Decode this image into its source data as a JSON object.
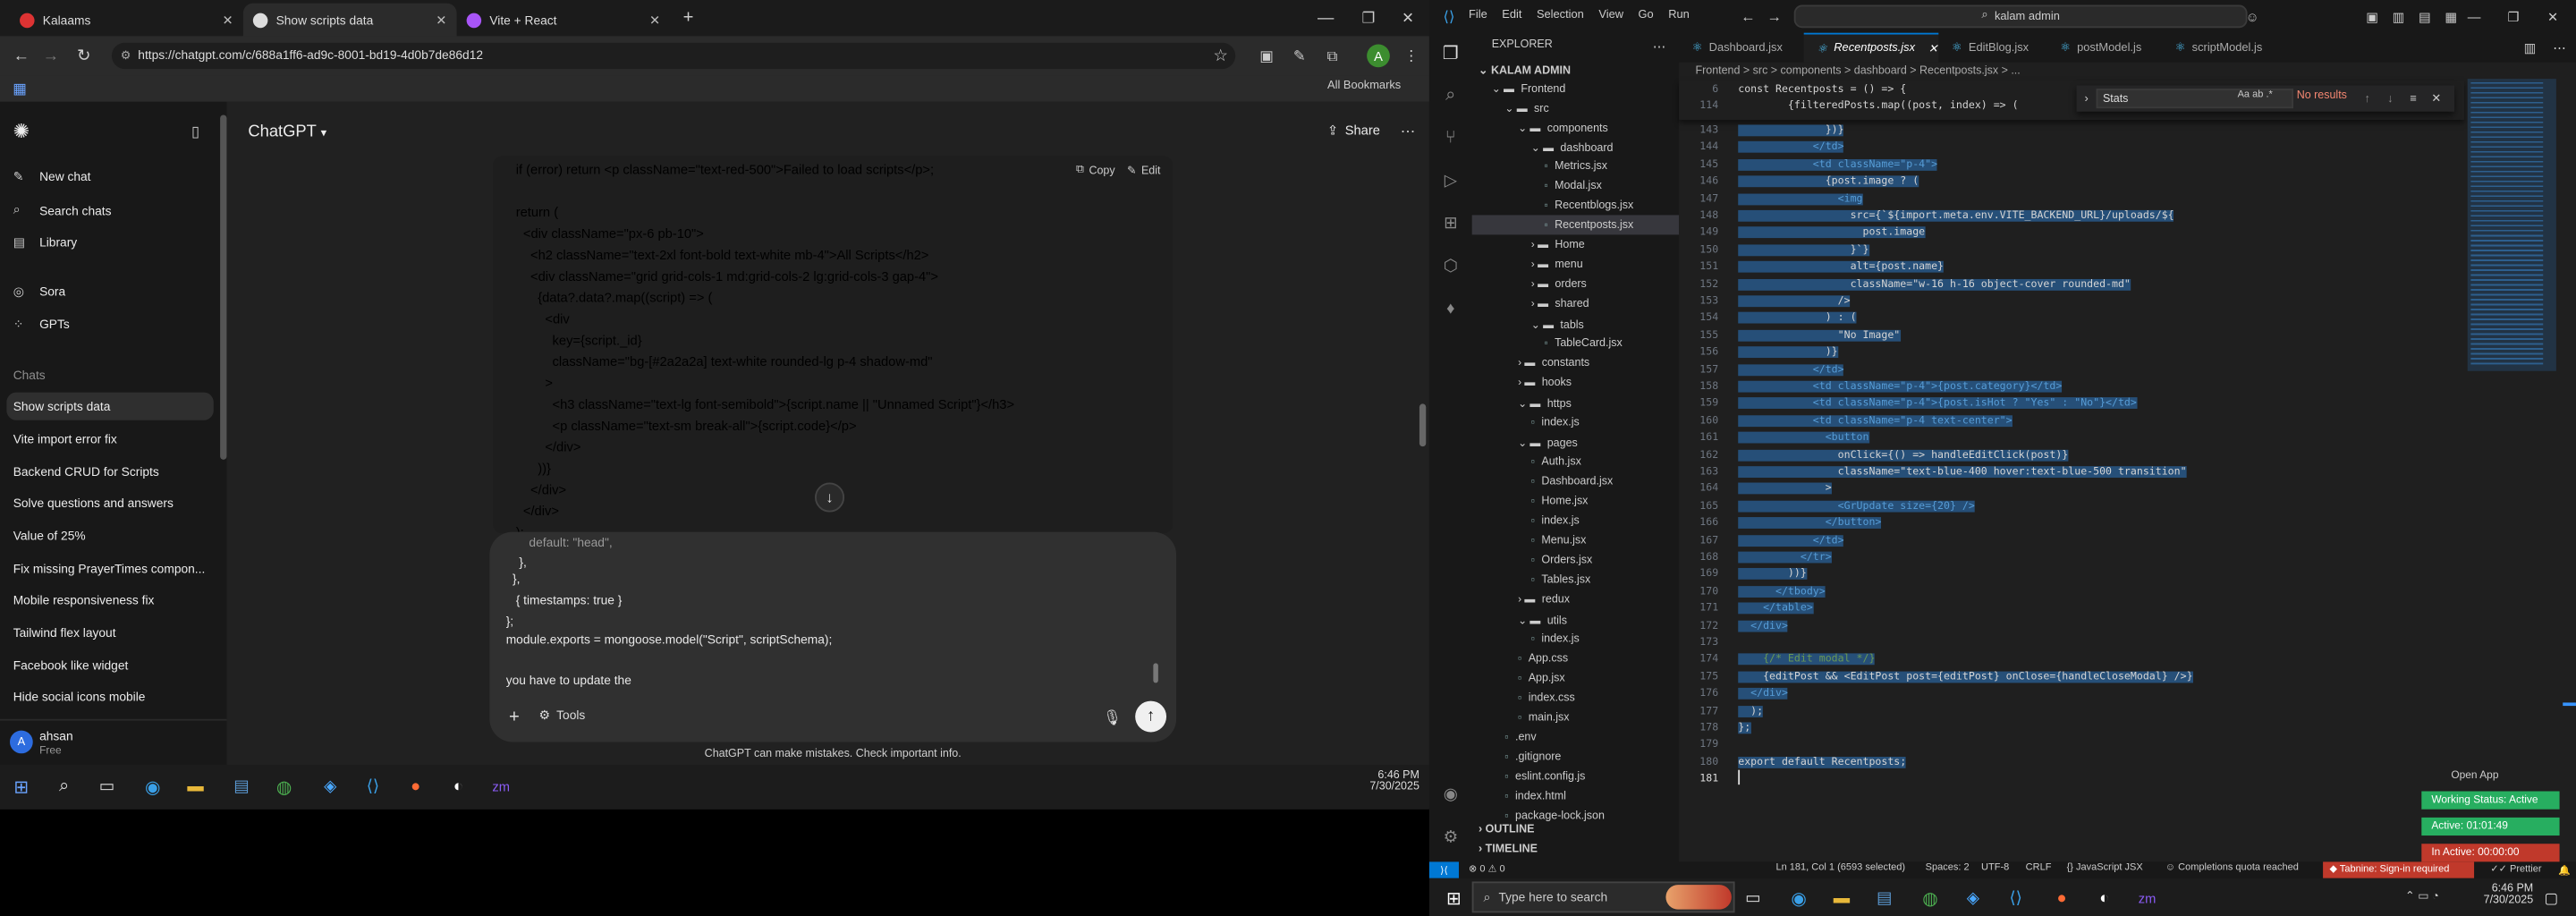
{
  "browser": {
    "tabs": [
      {
        "title": "Kalaams"
      },
      {
        "title": "Show scripts data"
      },
      {
        "title": "Vite + React"
      }
    ],
    "url": "https://chatgpt.com/c/688a1ff6-ad9c-8001-bd19-4d0b7de86d12",
    "bookmarks_label": "All Bookmarks"
  },
  "chatgpt": {
    "sidebar": {
      "top_items": [
        {
          "label": "New chat",
          "icon": "edit-icon"
        },
        {
          "label": "Search chats",
          "icon": "search-icon"
        },
        {
          "label": "Library",
          "icon": "library-icon"
        }
      ],
      "apps": [
        {
          "label": "Sora"
        },
        {
          "label": "GPTs"
        }
      ],
      "chats_heading": "Chats",
      "chats": [
        "Show scripts data",
        "Vite import error fix",
        "Backend CRUD for Scripts",
        "Solve questions and answers",
        "Value of 25%",
        "Fix missing PrayerTimes compon...",
        "Mobile responsiveness fix",
        "Tailwind flex layout",
        "Facebook like widget",
        "Hide social icons mobile"
      ],
      "user": {
        "name": "ahsan",
        "plan": "Free",
        "initial": "A"
      }
    },
    "header": {
      "title": "ChatGPT",
      "share": "Share"
    },
    "code": {
      "copy": "Copy",
      "edit": "Edit",
      "lines": [
        "if (error) return <p className=\"text-red-500\">Failed to load scripts</p>;",
        "",
        "return (",
        "  <div className=\"px-6 pb-10\">",
        "    <h2 className=\"text-2xl font-bold text-white mb-4\">All Scripts</h2>",
        "    <div className=\"grid grid-cols-1 md:grid-cols-2 lg:grid-cols-3 gap-4\">",
        "      {data?.data?.map((script) => (",
        "        <div",
        "          key={script._id}",
        "          className=\"bg-[#2a2a2a] text-white rounded-lg p-4 shadow-md\"",
        "        >",
        "          <h3 className=\"text-lg font-semibold\">{script.name || \"Unnamed Script\"}</h3>",
        "          <p className=\"text-sm break-all\">{script.code}</p>",
        "        </div>",
        "      ))}",
        "    </div>",
        "  </div>",
        ");"
      ]
    },
    "prompt": {
      "lines": [
        "default: \"head\",",
        "},",
        "},",
        "{ timestamps: true }",
        "};",
        "module.exports = mongoose.model(\"Script\", scriptSchema);",
        "",
        "you have to update the"
      ],
      "tools": "Tools"
    },
    "disclaimer": "ChatGPT can make mistakes. Check important info.",
    "taskbar": {
      "time": "6:46 PM",
      "date": "7/30/2025"
    }
  },
  "vscode": {
    "menu": [
      "File",
      "Edit",
      "Selection",
      "View",
      "Go",
      "Run"
    ],
    "search": "kalam admin",
    "explorer_title": "EXPLORER",
    "root": "KALAM ADMIN",
    "tree": [
      {
        "label": "Frontend",
        "depth": 0,
        "type": "folder-open"
      },
      {
        "label": "src",
        "depth": 1,
        "type": "folder-open"
      },
      {
        "label": "components",
        "depth": 2,
        "type": "folder-open"
      },
      {
        "label": "dashboard",
        "depth": 3,
        "type": "folder-open"
      },
      {
        "label": "Metrics.jsx",
        "depth": 4,
        "type": "file"
      },
      {
        "label": "Modal.jsx",
        "depth": 4,
        "type": "file"
      },
      {
        "label": "Recentblogs.jsx",
        "depth": 4,
        "type": "file"
      },
      {
        "label": "Recentposts.jsx",
        "depth": 4,
        "type": "file",
        "active": true
      },
      {
        "label": "Home",
        "depth": 3,
        "type": "folder"
      },
      {
        "label": "menu",
        "depth": 3,
        "type": "folder"
      },
      {
        "label": "orders",
        "depth": 3,
        "type": "folder"
      },
      {
        "label": "shared",
        "depth": 3,
        "type": "folder"
      },
      {
        "label": "tabls",
        "depth": 3,
        "type": "folder-open"
      },
      {
        "label": "TableCard.jsx",
        "depth": 4,
        "type": "file"
      },
      {
        "label": "constants",
        "depth": 2,
        "type": "folder"
      },
      {
        "label": "hooks",
        "depth": 2,
        "type": "folder"
      },
      {
        "label": "https",
        "depth": 2,
        "type": "folder-open"
      },
      {
        "label": "index.js",
        "depth": 3,
        "type": "file"
      },
      {
        "label": "pages",
        "depth": 2,
        "type": "folder-open"
      },
      {
        "label": "Auth.jsx",
        "depth": 3,
        "type": "file"
      },
      {
        "label": "Dashboard.jsx",
        "depth": 3,
        "type": "file"
      },
      {
        "label": "Home.jsx",
        "depth": 3,
        "type": "file"
      },
      {
        "label": "index.js",
        "depth": 3,
        "type": "file"
      },
      {
        "label": "Menu.jsx",
        "depth": 3,
        "type": "file"
      },
      {
        "label": "Orders.jsx",
        "depth": 3,
        "type": "file"
      },
      {
        "label": "Tables.jsx",
        "depth": 3,
        "type": "file"
      },
      {
        "label": "redux",
        "depth": 2,
        "type": "folder"
      },
      {
        "label": "utils",
        "depth": 2,
        "type": "folder-open"
      },
      {
        "label": "index.js",
        "depth": 3,
        "type": "file"
      },
      {
        "label": "App.css",
        "depth": 2,
        "type": "file"
      },
      {
        "label": "App.jsx",
        "depth": 2,
        "type": "file"
      },
      {
        "label": "index.css",
        "depth": 2,
        "type": "file"
      },
      {
        "label": "main.jsx",
        "depth": 2,
        "type": "file"
      },
      {
        "label": ".env",
        "depth": 1,
        "type": "file"
      },
      {
        "label": ".gitignore",
        "depth": 1,
        "type": "file"
      },
      {
        "label": "eslint.config.js",
        "depth": 1,
        "type": "file"
      },
      {
        "label": "index.html",
        "depth": 1,
        "type": "file"
      },
      {
        "label": "package-lock.json",
        "depth": 1,
        "type": "file"
      }
    ],
    "outline": "OUTLINE",
    "timeline": "TIMELINE",
    "tabs": [
      {
        "label": "Dashboard.jsx"
      },
      {
        "label": "Recentposts.jsx",
        "active": true
      },
      {
        "label": "EditBlog.jsx"
      },
      {
        "label": "postModel.js"
      },
      {
        "label": "scriptModel.js"
      }
    ],
    "breadcrumb": "Frontend > src > components > dashboard > Recentposts.jsx > ...",
    "sticky": [
      {
        "num": "6",
        "text": "const Recentposts = () => {"
      },
      {
        "num": "114",
        "text": "        {filteredPosts.map((post, index) => ("
      }
    ],
    "find": {
      "query": "Stats",
      "result": "No results"
    },
    "lines": [
      {
        "num": "143",
        "text": "              })}"
      },
      {
        "num": "144",
        "text": "            </td>"
      },
      {
        "num": "145",
        "text": "            <td className=\"p-4\">"
      },
      {
        "num": "146",
        "text": "              {post.image ? ("
      },
      {
        "num": "147",
        "text": "                <img"
      },
      {
        "num": "148",
        "text": "                  src={`${import.meta.env.VITE_BACKEND_URL}/uploads/${"
      },
      {
        "num": "149",
        "text": "                    post.image"
      },
      {
        "num": "150",
        "text": "                  }`}"
      },
      {
        "num": "151",
        "text": "                  alt={post.name}"
      },
      {
        "num": "152",
        "text": "                  className=\"w-16 h-16 object-cover rounded-md\""
      },
      {
        "num": "153",
        "text": "                />"
      },
      {
        "num": "154",
        "text": "              ) : ("
      },
      {
        "num": "155",
        "text": "                \"No Image\""
      },
      {
        "num": "156",
        "text": "              )}"
      },
      {
        "num": "157",
        "text": "            </td>"
      },
      {
        "num": "158",
        "text": "            <td className=\"p-4\">{post.category}</td>"
      },
      {
        "num": "159",
        "text": "            <td className=\"p-4\">{post.isHot ? \"Yes\" : \"No\"}</td>"
      },
      {
        "num": "160",
        "text": "            <td className=\"p-4 text-center\">"
      },
      {
        "num": "161",
        "text": "              <button"
      },
      {
        "num": "162",
        "text": "                onClick={() => handleEditClick(post)}"
      },
      {
        "num": "163",
        "text": "                className=\"text-blue-400 hover:text-blue-500 transition\""
      },
      {
        "num": "164",
        "text": "              >"
      },
      {
        "num": "165",
        "text": "                <GrUpdate size={20} />"
      },
      {
        "num": "166",
        "text": "              </button>"
      },
      {
        "num": "167",
        "text": "            </td>"
      },
      {
        "num": "168",
        "text": "          </tr>"
      },
      {
        "num": "169",
        "text": "        ))}"
      },
      {
        "num": "170",
        "text": "      </tbody>"
      },
      {
        "num": "171",
        "text": "    </table>"
      },
      {
        "num": "172",
        "text": "  </div>"
      },
      {
        "num": "173",
        "text": ""
      },
      {
        "num": "174",
        "text": "    {/* Edit modal */}"
      },
      {
        "num": "175",
        "text": "    {editPost && <EditPost post={editPost} onClose={handleCloseModal} />}"
      },
      {
        "num": "176",
        "text": "  </div>"
      },
      {
        "num": "177",
        "text": "  );"
      },
      {
        "num": "178",
        "text": "};"
      },
      {
        "num": "179",
        "text": ""
      },
      {
        "num": "180",
        "text": "export default Recentposts;"
      },
      {
        "num": "181",
        "text": ""
      }
    ],
    "status": {
      "position": "Ln 181, Col 1 (6593 selected)",
      "spaces": "Spaces: 2",
      "encoding": "UTF-8",
      "eol": "CRLF",
      "language": "JavaScript JSX",
      "quota": "Completions quota reached",
      "tabnine": "Tabnine: Sign-in required",
      "errors": "0",
      "warnings": "0"
    },
    "badges": {
      "open_app": "Open App",
      "working": "Working Status: Active",
      "active": "Active: 01:01:49",
      "inactive": "In Active: 00:00:00",
      "prettier": "Prettier"
    },
    "taskbar": {
      "search": "Type here to search",
      "time": "6:46 PM",
      "date": "7/30/2025"
    }
  }
}
